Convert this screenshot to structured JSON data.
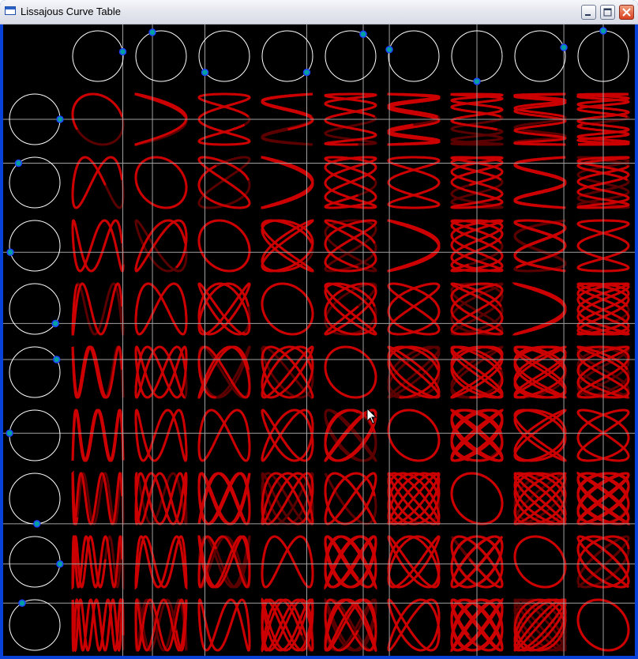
{
  "window": {
    "title": "Lissajous Curve Table",
    "minimize_label": "",
    "maximize_label": "",
    "close_label": ""
  },
  "table": {
    "cols": 9,
    "rows": 9,
    "colors": {
      "background": "#000000",
      "circle": "#ffffff",
      "guide": "#a0a0a0",
      "curve": "#e00000",
      "dot_fill": "#00a0a0",
      "dot_stroke": "#2040ff"
    },
    "col_dot_angles_deg": [
      10,
      110,
      220,
      320,
      60,
      165,
      270,
      20,
      90
    ],
    "row_dot_angles_deg": [
      0,
      130,
      195,
      325,
      30,
      175,
      275,
      355,
      120
    ]
  },
  "icons": {
    "app": "app-window-icon",
    "cursor": "mouse-pointer-icon"
  }
}
